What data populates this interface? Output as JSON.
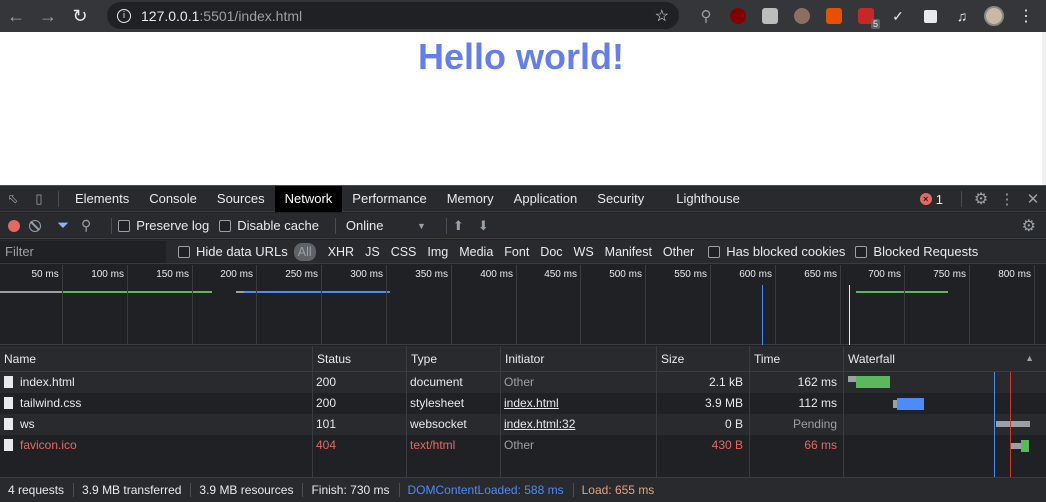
{
  "browser": {
    "url_host": "127.0.0.1",
    "url_rest": ":5501/index.html",
    "ext_badge": "5"
  },
  "page": {
    "heading": "Hello world!"
  },
  "devtools": {
    "tabs": [
      "Elements",
      "Console",
      "Sources",
      "Network",
      "Performance",
      "Memory",
      "Application",
      "Security",
      "Lighthouse"
    ],
    "selected_tab": "Network",
    "error_count": "1",
    "toolbar": {
      "preserve_log": "Preserve log",
      "disable_cache": "Disable cache",
      "throttle": "Online"
    },
    "filter": {
      "placeholder": "Filter",
      "hide_data_urls": "Hide data URLs",
      "types": [
        "All",
        "XHR",
        "JS",
        "CSS",
        "Img",
        "Media",
        "Font",
        "Doc",
        "WS",
        "Manifest",
        "Other"
      ],
      "has_blocked_cookies": "Has blocked cookies",
      "blocked_requests": "Blocked Requests"
    },
    "overview_ticks": [
      "50 ms",
      "100 ms",
      "150 ms",
      "200 ms",
      "250 ms",
      "300 ms",
      "350 ms",
      "400 ms",
      "450 ms",
      "500 ms",
      "550 ms",
      "600 ms",
      "650 ms",
      "700 ms",
      "750 ms",
      "800 ms"
    ],
    "columns": [
      "Name",
      "Status",
      "Type",
      "Initiator",
      "Size",
      "Time",
      "Waterfall"
    ],
    "rows": [
      {
        "name": "index.html",
        "status": "200",
        "type": "document",
        "initiator": "Other",
        "size": "2.1 kB",
        "time": "162 ms"
      },
      {
        "name": "tailwind.css",
        "status": "200",
        "type": "stylesheet",
        "initiator": "index.html",
        "size": "3.9 MB",
        "time": "112 ms"
      },
      {
        "name": "ws",
        "status": "101",
        "type": "websocket",
        "initiator": "index.html:32",
        "size": "0 B",
        "time": "Pending"
      },
      {
        "name": "favicon.ico",
        "status": "404",
        "type": "text/html",
        "initiator": "Other",
        "size": "430 B",
        "time": "66 ms"
      }
    ],
    "status_bar": {
      "requests": "4 requests",
      "transferred": "3.9 MB transferred",
      "resources": "3.9 MB resources",
      "finish": "Finish: 730 ms",
      "dom_content_loaded": "DOMContentLoaded: 588 ms",
      "load": "Load: 655 ms"
    },
    "colors": {
      "accent": "#8ab4f8",
      "error": "#e46962",
      "heading": "#667eea",
      "dcl": "#4d8bf7",
      "load": "#cc3b2f"
    }
  }
}
